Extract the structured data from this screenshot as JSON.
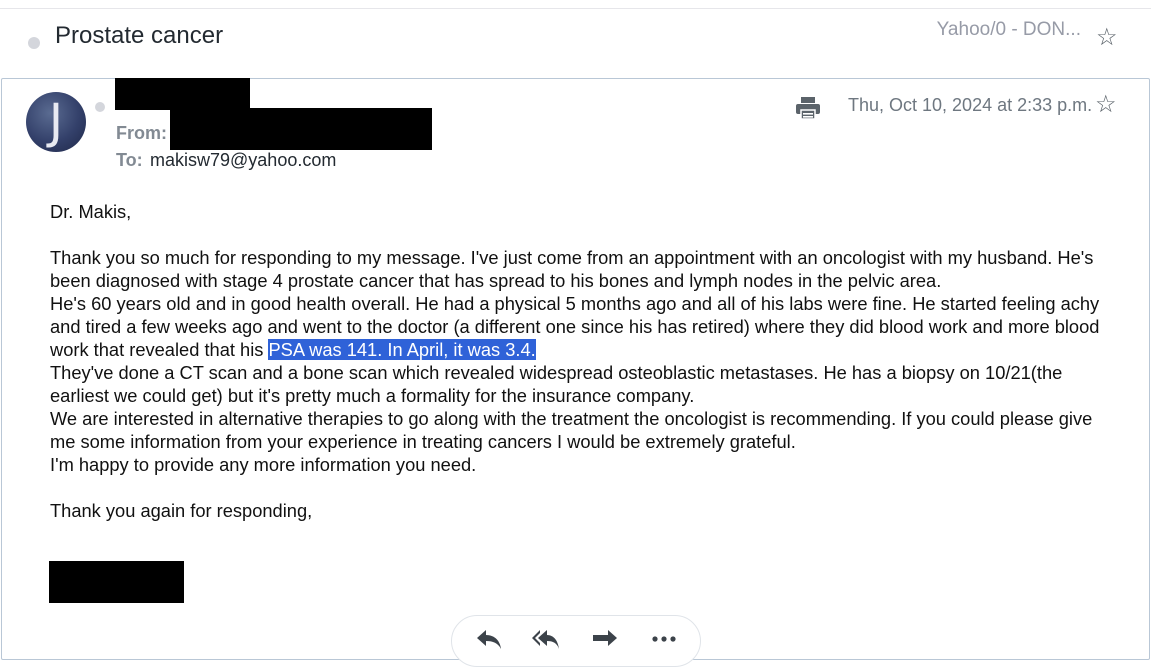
{
  "subject_bar": {
    "subject": "Prostate cancer",
    "folder": "Yahoo/0 - DON...",
    "star_icon": "star-outline-icon"
  },
  "message": {
    "from_label": "From:",
    "to_label": "To:",
    "to_value": "makisw79@yahoo.com",
    "date": "Thu, Oct 10, 2024 at 2:33 p.m.",
    "avatar_letter": "J",
    "greeting": "Dr. Makis,",
    "p1": "Thank you so much for responding to my message. I've just come from an appointment with an oncologist with my husband. He's been diagnosed with stage 4 prostate cancer that has spread to his bones and lymph nodes in the pelvic area.",
    "p2_before": "He's 60 years old and in good health overall. He had a physical 5 months ago and all of his labs were fine. He started feeling achy and tired a few weeks ago and went to the doctor (a different one since his has retired) where they did blood work and more blood work that revealed that his ",
    "p2_highlight": "PSA was 141. In April, it was 3.4.",
    "p3": "They've done a CT scan and a bone scan which revealed widespread osteoblastic metastases. He has a biopsy on 10/21(the earliest we could get) but it's pretty much a formality for the insurance company.",
    "p4": "We are interested in alternative therapies to go along with the treatment the oncologist is recommending. If you could please give me some information from your experience in treating cancers I would be extremely grateful.",
    "p5": "I'm happy to provide any more information you need.",
    "closing": "Thank you again for responding,"
  },
  "icons": {
    "print": "print-icon",
    "reply": "reply-icon",
    "reply_all": "reply-all-icon",
    "forward": "forward-icon",
    "more": "more-icon"
  },
  "colors": {
    "highlight": "#2f62d8",
    "card_border": "#b9c7d6",
    "meta_gray": "#828a93"
  }
}
